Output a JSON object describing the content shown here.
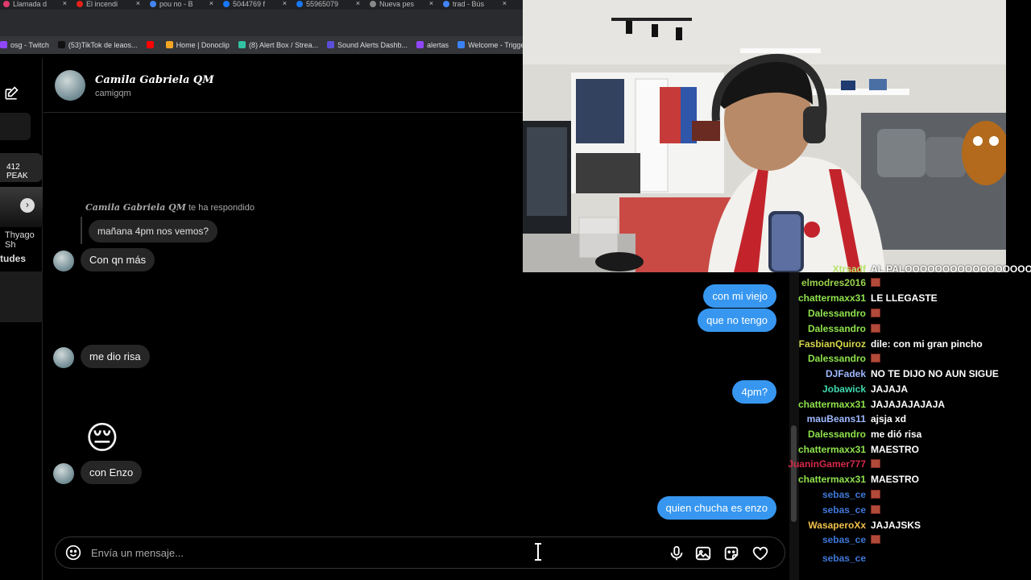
{
  "browser": {
    "tabs": [
      {
        "label": "Llamada d",
        "color": "#e23a6d"
      },
      {
        "label": "El incendi",
        "color": "#e62117"
      },
      {
        "label": "pou no - B",
        "color": "#4285f4"
      },
      {
        "label": "5044769 f",
        "color": "#1877f2"
      },
      {
        "label": "55965079",
        "color": "#1877f2"
      },
      {
        "label": "Nueva pes",
        "color": "#888888"
      },
      {
        "label": "trad - Bús",
        "color": "#4285f4"
      }
    ],
    "bookmarks": [
      {
        "label": "osg - Twitch",
        "color": "#9146ff"
      },
      {
        "label": "(53)TikTok de leaos...",
        "color": "#111111"
      },
      {
        "label": "",
        "color": "#ff0000"
      },
      {
        "label": "Home | Donoclip",
        "color": "#f5a623"
      },
      {
        "label": "(8) Alert Box / Strea...",
        "color": "#31c3a2"
      },
      {
        "label": "Sound Alerts Dashb...",
        "color": "#5b4fd8"
      },
      {
        "label": "alertas",
        "color": "#9146ff"
      },
      {
        "label": "Welcome - Triggerfy...",
        "color": "#3b82f6"
      }
    ]
  },
  "sidebar": {
    "peak_label": "412 PEAK",
    "person_label": "Thyago Sh",
    "section_label": "tudes"
  },
  "chat_header": {
    "name": "Camila Gabriela QM",
    "username": "camigqm"
  },
  "messages": {
    "reply_context_name": "Camila Gabriela QM",
    "reply_context_text": "te ha respondido",
    "quoted": "mañana 4pm nos vemos?",
    "in_1": "Con qn más",
    "out_1": "con mi viejo",
    "out_2": "que no tengo",
    "in_2": "me dio risa",
    "out_3": "4pm?",
    "emoji": "😔",
    "in_3": "con Enzo",
    "out_4": "quien chucha es enzo"
  },
  "composer": {
    "placeholder": "Envía un mensaje..."
  },
  "twitch_chat": [
    {
      "user": "Xtrsadf",
      "color": "#b7e36b",
      "text": "AL PALOOOOOOOOOOOOOOOOOOO",
      "emote": false
    },
    {
      "user": "elmodres2016",
      "color": "#9ad34c",
      "text": "",
      "emote": true
    },
    {
      "user": "chattermaxx31",
      "color": "#8fe34d",
      "text": "LE LLEGASTE",
      "emote": false
    },
    {
      "user": "Dalessandro",
      "color": "#8fe34d",
      "text": "",
      "emote": true
    },
    {
      "user": "Dalessandro",
      "color": "#8fe34d",
      "text": "",
      "emote": true
    },
    {
      "user": "FasbianQuiroz",
      "color": "#d4d64a",
      "text": "dile: con mi gran pincho",
      "emote": false
    },
    {
      "user": "Dalessandro",
      "color": "#8fe34d",
      "text": "",
      "emote": true
    },
    {
      "user": "DJFadek",
      "color": "#9fb8ff",
      "text": "NO TE DIJO NO AUN SIGUE",
      "emote": false
    },
    {
      "user": "Jobawick",
      "color": "#3fd9b0",
      "text": "JAJAJA",
      "emote": false
    },
    {
      "user": "chattermaxx31",
      "color": "#8fe34d",
      "text": "JAJAJAJAJAJA",
      "emote": false
    },
    {
      "user": "mauBeans11",
      "color": "#9fb8ff",
      "text": "ajsja xd",
      "emote": false
    },
    {
      "user": "Dalessandro",
      "color": "#8fe34d",
      "text": "me dió risa",
      "emote": false
    },
    {
      "user": "chattermaxx31",
      "color": "#8fe34d",
      "text": "MAESTRO",
      "emote": false
    },
    {
      "user": "JuaninGamer777",
      "color": "#d6294a",
      "text": "",
      "emote": true
    },
    {
      "user": "chattermaxx31",
      "color": "#8fe34d",
      "text": "MAESTRO",
      "emote": false
    },
    {
      "user": "sebas_ce",
      "color": "#3f78d9",
      "text": "",
      "emote": true
    },
    {
      "user": "sebas_ce",
      "color": "#3f78d9",
      "text": "",
      "emote": true
    },
    {
      "user": "WasaperoXx",
      "color": "#f0c04a",
      "text": "JAJAJSKS",
      "emote": false
    },
    {
      "user": "sebas_ce",
      "color": "#3f78d9",
      "text": "",
      "emote": true
    },
    {
      "user": "sebas_ce",
      "color": "#3f78d9",
      "text": "",
      "emote": false
    }
  ],
  "colors": {
    "outgoing_bubble": "#3797f0",
    "incoming_bubble": "#262626",
    "background": "#000000"
  }
}
